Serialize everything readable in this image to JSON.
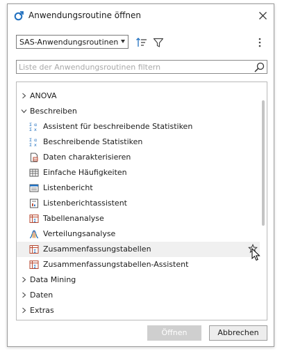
{
  "window": {
    "title": "Anwendungsroutine öffnen",
    "title_icon": "sas-task-icon",
    "close_icon": "close-icon"
  },
  "toolbar": {
    "category_select": {
      "value": "SAS-Anwendungsroutinen"
    },
    "sort_icon": "sort-icon",
    "filter_icon": "filter-icon",
    "more_icon": "more-vertical-icon"
  },
  "search": {
    "value": "",
    "placeholder": "Liste der Anwendungsroutinen filtern",
    "icon": "search-icon"
  },
  "tree": {
    "folders": {
      "anova": "ANOVA",
      "beschreiben": "Beschreiben",
      "data_mining": "Data Mining",
      "daten": "Daten",
      "extras": "Extras"
    },
    "items": [
      {
        "label": "Assistent für beschreibende Statistiken",
        "icon": "stats-sigma-icon"
      },
      {
        "label": "Beschreibende Statistiken",
        "icon": "stats-sigma-icon"
      },
      {
        "label": "Daten charakterisieren",
        "icon": "data-document-icon"
      },
      {
        "label": "Einfache Häufigkeiten",
        "icon": "frequency-table-icon"
      },
      {
        "label": "Listenbericht",
        "icon": "list-report-icon"
      },
      {
        "label": "Listenberichtassistent",
        "icon": "report-wizard-icon"
      },
      {
        "label": "Tabellenanalyse",
        "icon": "table-sigma-icon"
      },
      {
        "label": "Verteilungsanalyse",
        "icon": "distribution-curve-icon"
      },
      {
        "label": "Zusammenfassungstabellen",
        "icon": "table-sigma-icon",
        "selected": true
      },
      {
        "label": "Zusammenfassungstabellen-Assistent",
        "icon": "table-sigma-icon"
      }
    ],
    "selected_row_favorite_icon": "star-outline-icon"
  },
  "buttons": {
    "open": "Öffnen",
    "cancel": "Abbrechen"
  },
  "colors": {
    "accent_blue": "#1f6fbf",
    "icon_red": "#b6462e",
    "selected_row": "#f0f0f0",
    "disabled_button": "#cfcfcf"
  }
}
